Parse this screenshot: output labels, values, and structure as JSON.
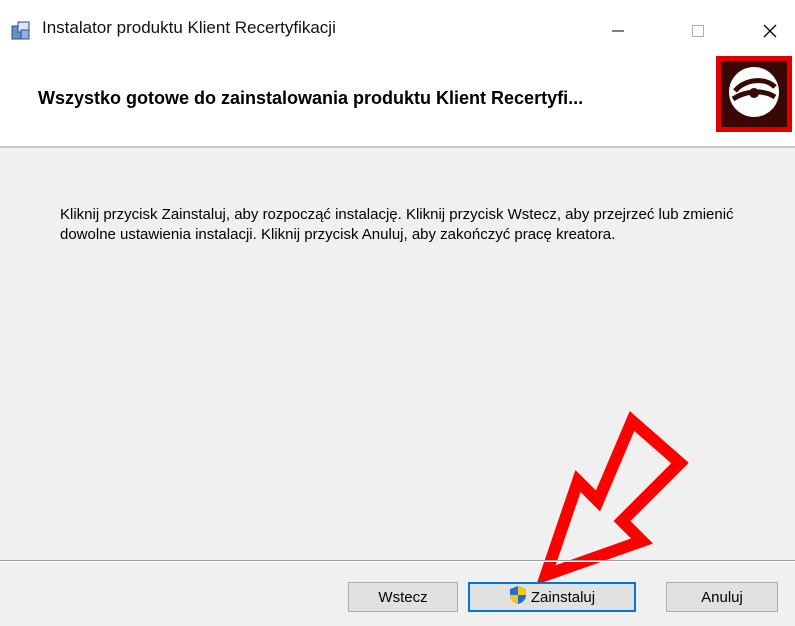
{
  "window": {
    "title": "Instalator produktu Klient Recertyfikacji",
    "controls": {
      "minimize": "minimize-icon",
      "maximize": "maximize-icon",
      "close": "close-icon"
    }
  },
  "header": {
    "title": "Wszystko gotowe do zainstalowania produktu Klient Recertyfi...",
    "logo": "disc-icon"
  },
  "body": {
    "instructions": "Kliknij przycisk Zainstaluj, aby rozpocząć instalację. Kliknij przycisk Wstecz, aby przejrzeć lub zmienić dowolne ustawienia instalacji. Kliknij przycisk Anuluj, aby zakończyć pracę kreatora."
  },
  "buttons": {
    "back": "Wstecz",
    "install": "Zainstaluj",
    "cancel": "Anuluj"
  },
  "annotation": {
    "arrow_color": "#ff0000"
  },
  "colors": {
    "accent": "#0078d7",
    "logo_bg": "#e00000"
  }
}
